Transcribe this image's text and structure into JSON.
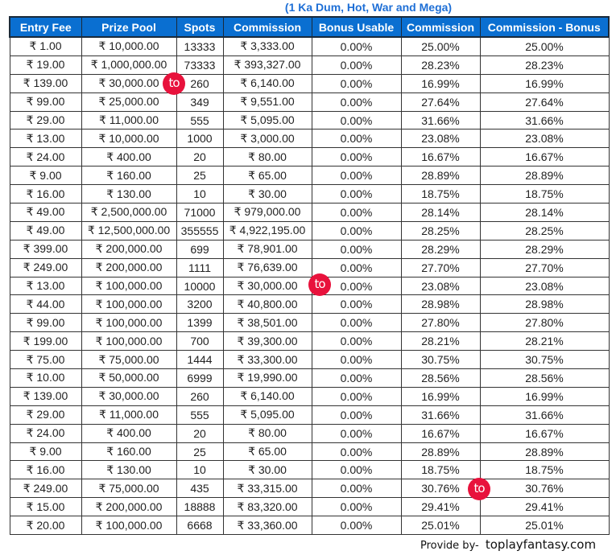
{
  "title": "(1 Ka Dum, Hot, War and Mega)",
  "table": {
    "headers": [
      "Entry Fee",
      "Prize Pool",
      "Spots",
      "Commission",
      "Bonus Usable",
      "Commission",
      "Commission - Bonus"
    ],
    "rows": [
      [
        "₹ 1.00",
        "₹ 10,000.00",
        "13333",
        "₹ 3,333.00",
        "0.00%",
        "25.00%",
        "25.00%"
      ],
      [
        "₹ 19.00",
        "₹ 1,000,000.00",
        "73333",
        "₹ 393,327.00",
        "0.00%",
        "28.23%",
        "28.23%"
      ],
      [
        "₹ 139.00",
        "₹ 30,000.00",
        "260",
        "₹ 6,140.00",
        "0.00%",
        "16.99%",
        "16.99%"
      ],
      [
        "₹ 99.00",
        "₹ 25,000.00",
        "349",
        "₹ 9,551.00",
        "0.00%",
        "27.64%",
        "27.64%"
      ],
      [
        "₹ 29.00",
        "₹ 11,000.00",
        "555",
        "₹ 5,095.00",
        "0.00%",
        "31.66%",
        "31.66%"
      ],
      [
        "₹ 13.00",
        "₹ 10,000.00",
        "1000",
        "₹ 3,000.00",
        "0.00%",
        "23.08%",
        "23.08%"
      ],
      [
        "₹ 24.00",
        "₹ 400.00",
        "20",
        "₹ 80.00",
        "0.00%",
        "16.67%",
        "16.67%"
      ],
      [
        "₹ 9.00",
        "₹ 160.00",
        "25",
        "₹ 65.00",
        "0.00%",
        "28.89%",
        "28.89%"
      ],
      [
        "₹ 16.00",
        "₹ 130.00",
        "10",
        "₹ 30.00",
        "0.00%",
        "18.75%",
        "18.75%"
      ],
      [
        "₹ 49.00",
        "₹ 2,500,000.00",
        "71000",
        "₹ 979,000.00",
        "0.00%",
        "28.14%",
        "28.14%"
      ],
      [
        "₹ 49.00",
        "₹ 12,500,000.00",
        "355555",
        "₹ 4,922,195.00",
        "0.00%",
        "28.25%",
        "28.25%"
      ],
      [
        "₹ 399.00",
        "₹ 200,000.00",
        "699",
        "₹ 78,901.00",
        "0.00%",
        "28.29%",
        "28.29%"
      ],
      [
        "₹ 249.00",
        "₹ 200,000.00",
        "1111",
        "₹ 76,639.00",
        "0.00%",
        "27.70%",
        "27.70%"
      ],
      [
        "₹ 13.00",
        "₹ 100,000.00",
        "10000",
        "₹ 30,000.00",
        "0.00%",
        "23.08%",
        "23.08%"
      ],
      [
        "₹ 44.00",
        "₹ 100,000.00",
        "3200",
        "₹ 40,800.00",
        "0.00%",
        "28.98%",
        "28.98%"
      ],
      [
        "₹ 99.00",
        "₹ 100,000.00",
        "1399",
        "₹ 38,501.00",
        "0.00%",
        "27.80%",
        "27.80%"
      ],
      [
        "₹ 199.00",
        "₹ 100,000.00",
        "700",
        "₹ 39,300.00",
        "0.00%",
        "28.21%",
        "28.21%"
      ],
      [
        "₹ 75.00",
        "₹ 75,000.00",
        "1444",
        "₹ 33,300.00",
        "0.00%",
        "30.75%",
        "30.75%"
      ],
      [
        "₹ 10.00",
        "₹ 50,000.00",
        "6999",
        "₹ 19,990.00",
        "0.00%",
        "28.56%",
        "28.56%"
      ],
      [
        "₹ 139.00",
        "₹ 30,000.00",
        "260",
        "₹ 6,140.00",
        "0.00%",
        "16.99%",
        "16.99%"
      ],
      [
        "₹ 29.00",
        "₹ 11,000.00",
        "555",
        "₹ 5,095.00",
        "0.00%",
        "31.66%",
        "31.66%"
      ],
      [
        "₹ 24.00",
        "₹ 400.00",
        "20",
        "₹ 80.00",
        "0.00%",
        "16.67%",
        "16.67%"
      ],
      [
        "₹ 9.00",
        "₹ 160.00",
        "25",
        "₹ 65.00",
        "0.00%",
        "28.89%",
        "28.89%"
      ],
      [
        "₹ 16.00",
        "₹ 130.00",
        "10",
        "₹ 30.00",
        "0.00%",
        "18.75%",
        "18.75%"
      ],
      [
        "₹ 249.00",
        "₹ 75,000.00",
        "435",
        "₹ 33,315.00",
        "0.00%",
        "30.76%",
        "30.76%"
      ],
      [
        "₹ 15.00",
        "₹ 200,000.00",
        "18888",
        "₹ 83,320.00",
        "0.00%",
        "29.41%",
        "29.41%"
      ],
      [
        "₹ 20.00",
        "₹ 100,000.00",
        "6668",
        "₹ 33,360.00",
        "0.00%",
        "25.01%",
        "25.01%"
      ]
    ]
  },
  "watermark": {
    "text": "to",
    "color": "#e8123c"
  },
  "footer": {
    "prefix": "Provide by-",
    "brand": "toplayfantasy.com"
  },
  "colors": {
    "header_bg": "#0a6fd1",
    "title": "#1e6fd6"
  }
}
